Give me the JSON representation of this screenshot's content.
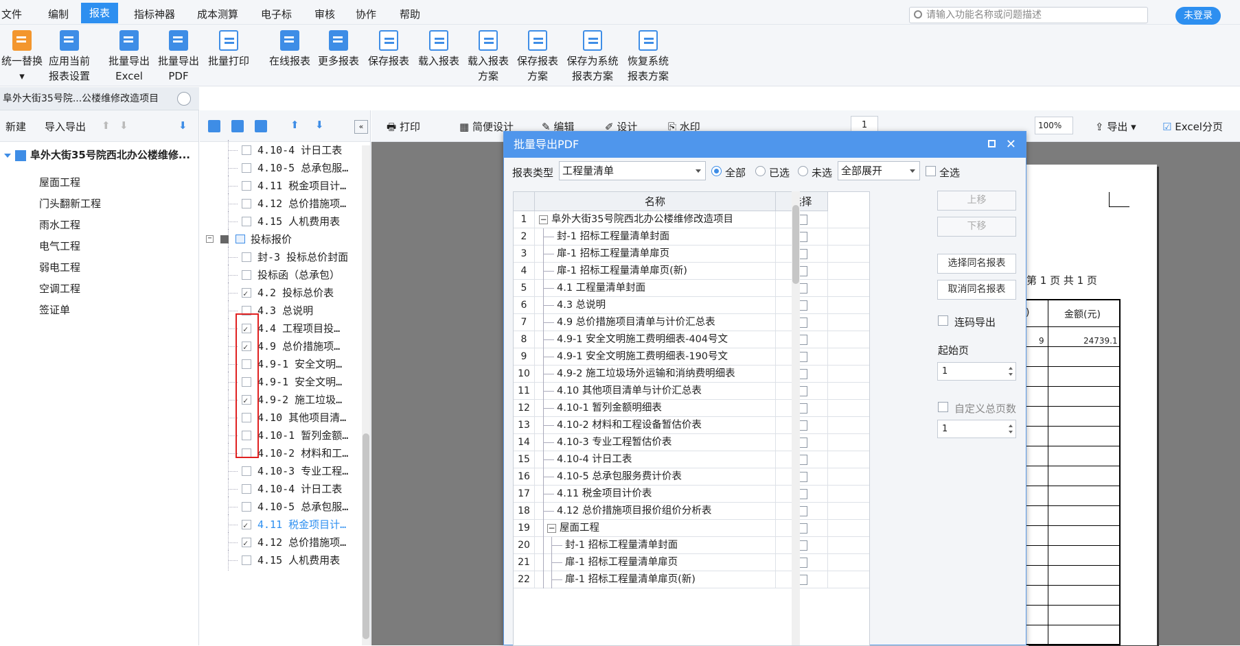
{
  "menu": {
    "items": [
      "文件",
      "编制",
      "报表",
      "指标神器",
      "成本测算",
      "电子标",
      "审核",
      "协作",
      "帮助"
    ]
  },
  "search": {
    "placeholder": "请输入功能名称或问题描述"
  },
  "login": {
    "label": "未登录"
  },
  "toolbar": {
    "buttons": [
      {
        "line1": "统一替换",
        "line2": "▾"
      },
      {
        "line1": "应用当前",
        "line2": "报表设置"
      },
      {
        "line1": "批量导出",
        "line2": "Excel"
      },
      {
        "line1": "批量导出",
        "line2": "PDF"
      },
      {
        "line1": "批量打印",
        "line2": ""
      },
      {
        "line1": "在线报表",
        "line2": ""
      },
      {
        "line1": "更多报表",
        "line2": ""
      },
      {
        "line1": "保存报表",
        "line2": ""
      },
      {
        "line1": "载入报表",
        "line2": ""
      },
      {
        "line1": "载入报表",
        "line2": "方案"
      },
      {
        "line1": "保存报表",
        "line2": "方案"
      },
      {
        "line1": "保存为系统",
        "line2": "报表方案"
      },
      {
        "line1": "恢复系统",
        "line2": "报表方案"
      }
    ]
  },
  "project": {
    "title": "阜外大街35号院...公楼维修改造项目"
  },
  "left": {
    "new_label": "新建",
    "import_label": "导入导出",
    "root": "阜外大街35号院西北办公楼维修...",
    "children": [
      "屋面工程",
      "门头翻新工程",
      "雨水工程",
      "电气工程",
      "弱电工程",
      "空调工程",
      "签证单"
    ]
  },
  "tree": {
    "rows": [
      {
        "text": "4.10-4 计日工表",
        "checked": false
      },
      {
        "text": "4.10-5 总承包服…",
        "checked": false
      },
      {
        "text": "4.11 税金项目计…",
        "checked": false
      },
      {
        "text": "4.12 总价措施项…",
        "checked": false
      },
      {
        "text": "4.15 人机费用表",
        "checked": false
      },
      {
        "text": "投标报价",
        "checked": false,
        "group": true
      },
      {
        "text": "封-3 投标总价封面",
        "checked": false
      },
      {
        "text": "投标函（总承包）",
        "checked": false
      },
      {
        "text": "4.2 投标总价表",
        "checked": true
      },
      {
        "text": "4.3 总说明",
        "checked": false
      },
      {
        "text": "4.4 工程项目投…",
        "checked": true
      },
      {
        "text": "4.9 总价措施项…",
        "checked": true
      },
      {
        "text": "4.9-1 安全文明…",
        "checked": false
      },
      {
        "text": "4.9-1 安全文明…",
        "checked": false
      },
      {
        "text": "4.9-2 施工垃圾…",
        "checked": true
      },
      {
        "text": "4.10 其他项目清…",
        "checked": false
      },
      {
        "text": "4.10-1 暂列金额…",
        "checked": false
      },
      {
        "text": "4.10-2 材料和工…",
        "checked": false
      },
      {
        "text": "4.10-3 专业工程…",
        "checked": false
      },
      {
        "text": "4.10-4 计日工表",
        "checked": false
      },
      {
        "text": "4.10-5 总承包服…",
        "checked": false
      },
      {
        "text": "4.11 税金项目计…",
        "checked": true,
        "highlight": true
      },
      {
        "text": "4.12 总价措施项…",
        "checked": true
      },
      {
        "text": "4.15 人机费用表",
        "checked": false
      }
    ]
  },
  "report_toolbar": {
    "print": "打印",
    "simple_design": "简便设计",
    "edit": "编辑",
    "design": "设计",
    "watermark": "水印",
    "page": "1",
    "zoom": "100%",
    "export": "导出",
    "excel_paging": "Excel分页"
  },
  "dialog": {
    "title": "批量导出PDF",
    "report_type_label": "报表类型",
    "report_type_value": "工程量清单",
    "radio_all": "全部",
    "radio_selected": "已选",
    "radio_unselected": "未选",
    "expand_value": "全部展开",
    "select_all": "全选",
    "col_name": "名称",
    "col_select": "选择",
    "rows": [
      {
        "no": "1",
        "name": "阜外大街35号院西北办公楼维修改造项目",
        "level": 0
      },
      {
        "no": "2",
        "name": "封-1 招标工程量清单封面",
        "level": 1
      },
      {
        "no": "3",
        "name": "扉-1 招标工程量清单扉页",
        "level": 1
      },
      {
        "no": "4",
        "name": "扉-1 招标工程量清单扉页(新)",
        "level": 1
      },
      {
        "no": "5",
        "name": "4.1 工程量清单封面",
        "level": 1
      },
      {
        "no": "6",
        "name": "4.3 总说明",
        "level": 1
      },
      {
        "no": "7",
        "name": "4.9 总价措施项目清单与计价汇总表",
        "level": 1
      },
      {
        "no": "8",
        "name": "4.9-1 安全文明施工费明细表-404号文",
        "level": 1
      },
      {
        "no": "9",
        "name": "4.9-1 安全文明施工费明细表-190号文",
        "level": 1
      },
      {
        "no": "10",
        "name": "4.9-2 施工垃圾场外运输和消纳费明细表",
        "level": 1
      },
      {
        "no": "11",
        "name": "4.10 其他项目清单与计价汇总表",
        "level": 1
      },
      {
        "no": "12",
        "name": "4.10-1 暂列金额明细表",
        "level": 1
      },
      {
        "no": "13",
        "name": "4.10-2 材料和工程设备暂估价表",
        "level": 1
      },
      {
        "no": "14",
        "name": "4.10-3 专业工程暂估价表",
        "level": 1
      },
      {
        "no": "15",
        "name": "4.10-4 计日工表",
        "level": 1
      },
      {
        "no": "16",
        "name": "4.10-5 总承包服务费计价表",
        "level": 1
      },
      {
        "no": "17",
        "name": "4.11 税金项目计价表",
        "level": 1
      },
      {
        "no": "18",
        "name": "4.12 总价措施项目报价组价分析表",
        "level": 1
      },
      {
        "no": "19",
        "name": "屋面工程",
        "level": 1,
        "group": true
      },
      {
        "no": "20",
        "name": "封-1 招标工程量清单封面",
        "level": 2
      },
      {
        "no": "21",
        "name": "扉-1 招标工程量清单扉页",
        "level": 2
      },
      {
        "no": "22",
        "name": "扉-1 招标工程量清单扉页(新)",
        "level": 2
      }
    ],
    "btn_up": "上移",
    "btn_down": "下移",
    "btn_select_same": "选择同名报表",
    "btn_cancel_same": "取消同名报表",
    "continuous_label": "连码导出",
    "start_page_label": "起始页",
    "start_page_value": "1",
    "custom_total_label": "自定义总页数",
    "custom_total_value": "1"
  },
  "paper": {
    "page_text": "第 1 页 共 1 页",
    "col_header_partial": ")",
    "col_amount": "金额(元)",
    "cell_count": "9",
    "cell_amount": "24739.1"
  }
}
